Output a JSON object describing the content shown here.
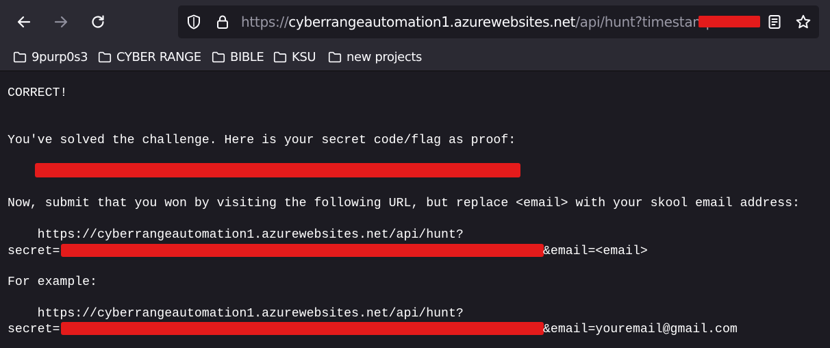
{
  "browser": {
    "url": {
      "host_prefix": "https://",
      "host": "cyberrangeautomation1.azurewebsites.net",
      "path": "/api/hunt?timestamp="
    },
    "bookmarks": [
      {
        "label": "9purp0s3"
      },
      {
        "label": "CYBER RANGE"
      },
      {
        "label": "BIBLE"
      },
      {
        "label": "KSU"
      },
      {
        "label": "new projects"
      }
    ]
  },
  "page": {
    "status": "CORRECT!",
    "solved_text": "You've solved the challenge. Here is your secret code/flag as proof:",
    "submit_instruction": "Now, submit that you won by visiting the following URL, but replace <email> with your skool email address:",
    "submit_url_line": "    https://cyberrangeautomation1.azurewebsites.net/api/hunt?",
    "submit_secret_prefix": "secret=",
    "submit_email_suffix": "&email=<email>",
    "example_heading": "For example:",
    "example_url_line": "    https://cyberrangeautomation1.azurewebsites.net/api/hunt?",
    "example_secret_prefix": "secret=",
    "example_email_suffix": "&email=youremail@gmail.com"
  },
  "colors": {
    "chrome": "#2b2a33",
    "background": "#1c1b22",
    "redaction": "#e41b1b",
    "text": "#ffffff"
  }
}
